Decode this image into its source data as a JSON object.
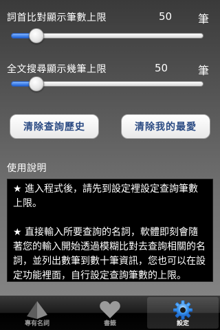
{
  "settings": {
    "exact_limit": {
      "label": "詞首比對顯示筆數上限",
      "value": "50",
      "unit": "筆",
      "level": 0.1
    },
    "fulltext_limit": {
      "label": "全文搜尋顯示幾筆上限",
      "value": "50",
      "unit": "筆",
      "level": 0.1
    }
  },
  "buttons": {
    "clear_history": "清除查詢歷史",
    "clear_favorites": "清除我的最愛"
  },
  "help": {
    "title": "使用說明",
    "para1": "★ 進入程式後，請先到設定裡設定查詢筆數上限。",
    "para2": "★ 直接輸入所要查詢的名詞，軟體即刻會隨著您的輸入開始透過模糊比對去查詢相關的名詞，並列出數筆到數十筆資訊，您也可以在設定功能裡面，自行設定查詢筆數的上限。"
  },
  "tabs": [
    {
      "label": "專有名詞",
      "icon": "pyramid-icon",
      "selected": false
    },
    {
      "label": "書籤",
      "icon": "heart-icon",
      "selected": false
    },
    {
      "label": "設定",
      "icon": "gear-icon",
      "selected": true
    }
  ],
  "colors": {
    "accent": "#1f63d8",
    "button_text": "#2a4a83"
  }
}
